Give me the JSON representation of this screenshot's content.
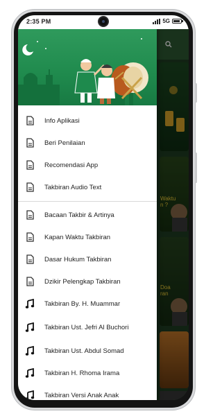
{
  "status_bar": {
    "time": "2:35 PM",
    "network": "5G"
  },
  "drawer": {
    "group1": [
      {
        "label": "Info Aplikasi",
        "icon": "document-icon"
      },
      {
        "label": "Beri Penilaian",
        "icon": "document-icon"
      },
      {
        "label": "Recomendasi App",
        "icon": "document-icon"
      },
      {
        "label": "Takbiran Audio Text",
        "icon": "document-icon"
      }
    ],
    "group2": [
      {
        "label": "Bacaan Takbir & Artinya",
        "icon": "document-icon"
      },
      {
        "label": "Kapan Waktu Takbiran",
        "icon": "document-icon"
      },
      {
        "label": "Dasar Hukum Takbiran",
        "icon": "document-icon"
      },
      {
        "label": "Dzikir Pelengkap Takbiran",
        "icon": "document-icon"
      },
      {
        "label": "Takbiran By. H. Muammar",
        "icon": "music-note-icon"
      },
      {
        "label": "Takbiran Ust. Jefri Al Buchori",
        "icon": "music-note-icon"
      },
      {
        "label": "Takbiran Ust. Abdul Somad",
        "icon": "music-note-icon"
      },
      {
        "label": "Takbiran H. Rhoma Irama",
        "icon": "music-note-icon"
      },
      {
        "label": "Takbiran Versi Anak Anak",
        "icon": "music-note-icon"
      }
    ]
  },
  "background": {
    "card2_text": "Waktu\nn ?",
    "card3_text": "Doa\nran"
  },
  "colors": {
    "header_green": "#2f9a5c",
    "app_green": "#2f5b34",
    "drawer_bg": "#ffffff"
  }
}
